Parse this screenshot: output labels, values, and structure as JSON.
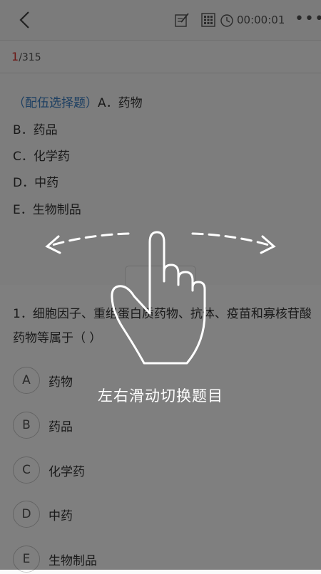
{
  "header": {
    "timer": "00:00:01",
    "more": "•••"
  },
  "progress": {
    "current": "1",
    "total": "/315"
  },
  "group": {
    "tag": "（配伍选择题）",
    "options": [
      "A．药物",
      "B．药品",
      "C．化学药",
      "D．中药",
      "E．生物制品"
    ]
  },
  "question": {
    "text": "1．细胞因子、重组蛋白质药物、抗体、疫苗和寡核苷酸药物等属于（ ）",
    "options": [
      {
        "letter": "A",
        "text": "药物"
      },
      {
        "letter": "B",
        "text": "药品"
      },
      {
        "letter": "C",
        "text": "化学药"
      },
      {
        "letter": "D",
        "text": "中药"
      },
      {
        "letter": "E",
        "text": "生物制品"
      }
    ]
  },
  "guide": {
    "hint": "左右滑动切换题目"
  },
  "icons": {
    "back": "chevron-left-icon",
    "edit": "edit-note-icon",
    "grid": "answer-sheet-grid-icon",
    "clock": "clock-icon",
    "hand": "swipe-hand-icon"
  }
}
